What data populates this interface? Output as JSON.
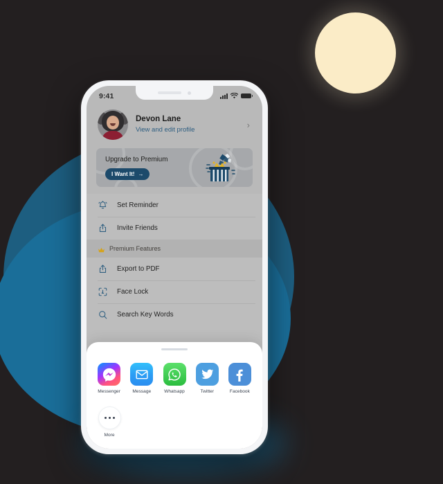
{
  "background": {
    "page_bg": "#231f20",
    "yellow_circle_color": "#fbecc7",
    "blue_blob_dark": "#1d5e80",
    "blue_blob_light": "#1a6e99"
  },
  "phone": {
    "statusbar": {
      "time": "9:41",
      "signal_icon": "cellular-bars-icon",
      "wifi_icon": "wifi-icon",
      "battery_icon": "battery-icon"
    },
    "profile": {
      "avatar_icon": "avatar",
      "name": "Devon Lane",
      "link": "View and edit profile",
      "chevron": "›"
    },
    "banner": {
      "title": "Upgrade to Premium",
      "cta_label": "I Want It!",
      "cta_arrow": "→",
      "cta_color": "#1c4a6b",
      "illustration_icon": "gift-box-with-crown-icon"
    },
    "menu": [
      {
        "icon": "alarm-bell-icon",
        "label": "Set Reminder",
        "type": "item"
      },
      {
        "icon": "share-upload-icon",
        "label": "Invite Friends",
        "type": "item"
      },
      {
        "icon": "crown-icon",
        "label": "Premium Features",
        "type": "section",
        "accent": "#d6a319"
      },
      {
        "icon": "share-upload-icon",
        "label": "Export to PDF",
        "type": "item"
      },
      {
        "icon": "face-id-icon",
        "label": "Face Lock",
        "type": "item"
      },
      {
        "icon": "search-icon",
        "label": "Search Key Words",
        "type": "item"
      }
    ],
    "share_sheet": {
      "grabber_icon": "drag-handle",
      "apps": [
        {
          "name": "Messenger",
          "icon": "messenger-icon",
          "color": "#9b4bd6"
        },
        {
          "name": "Message",
          "icon": "message-envelope-icon",
          "color": "#2fb8f5"
        },
        {
          "name": "Whatsapp",
          "icon": "whatsapp-icon",
          "color": "#3fcc52"
        },
        {
          "name": "Twitter",
          "icon": "twitter-bird-icon",
          "color": "#4d9fe0"
        },
        {
          "name": "Facebook",
          "icon": "facebook-f-icon",
          "color": "#4c8fd8"
        }
      ],
      "more": {
        "label": "More",
        "icon": "ellipsis-icon"
      }
    }
  }
}
